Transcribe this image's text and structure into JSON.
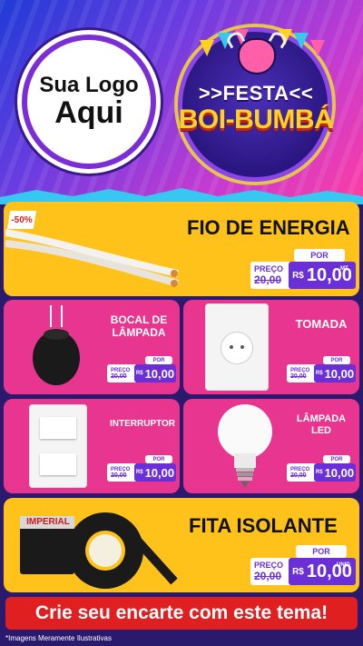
{
  "logo": {
    "line1": "Sua Logo",
    "line2": "Aqui"
  },
  "festa": {
    "line1": ">>FESTA<<",
    "line2": "BOI-BUMBÁ"
  },
  "products": [
    {
      "name": "FIO DE ENERGIA",
      "discount_badge": "-50%",
      "price_label": "PREÇO",
      "por_label": "POR",
      "old_prefix": "R$",
      "old_price": "20,00",
      "new_prefix": "R$",
      "new_price": "10,00",
      "unit": "MT"
    },
    {
      "name_line1": "BOCAL DE",
      "name_line2": "LÂMPADA",
      "price_label": "PREÇO",
      "por_label": "POR",
      "old_prefix": "R$",
      "old_price": "20,00",
      "new_prefix": "R$",
      "new_price": "10,00",
      "unit": "UNID"
    },
    {
      "name": "TOMADA",
      "price_label": "PREÇO",
      "por_label": "POR",
      "old_prefix": "R$",
      "old_price": "20,00",
      "new_prefix": "R$",
      "new_price": "10,00",
      "unit": "UNID"
    },
    {
      "name": "INTERRUPTOR",
      "price_label": "PREÇO",
      "por_label": "POR",
      "old_prefix": "R$",
      "old_price": "20,00",
      "new_prefix": "R$",
      "new_price": "10,00",
      "unit": "UNID"
    },
    {
      "name_line1": "LÂMPADA",
      "name_line2": "LED",
      "price_label": "PREÇO",
      "por_label": "POR",
      "old_prefix": "R$",
      "old_price": "20,00",
      "new_prefix": "R$",
      "new_price": "10,00",
      "unit": "UNID"
    },
    {
      "name": "FITA ISOLANTE",
      "price_label": "PREÇO",
      "por_label": "POR",
      "old_prefix": "R$",
      "old_price": "20,00",
      "new_prefix": "R$",
      "new_price": "10,00",
      "unit": "UNID"
    }
  ],
  "tape_brand": "IMPERIAL",
  "cta": "Crie seu encarte com este tema!",
  "footer": "*Imagens Meramente Ilustrativas",
  "colors": {
    "yellow": "#ffc21a",
    "pink": "#e8358f",
    "purple": "#6a2fd6",
    "red": "#e02020"
  }
}
